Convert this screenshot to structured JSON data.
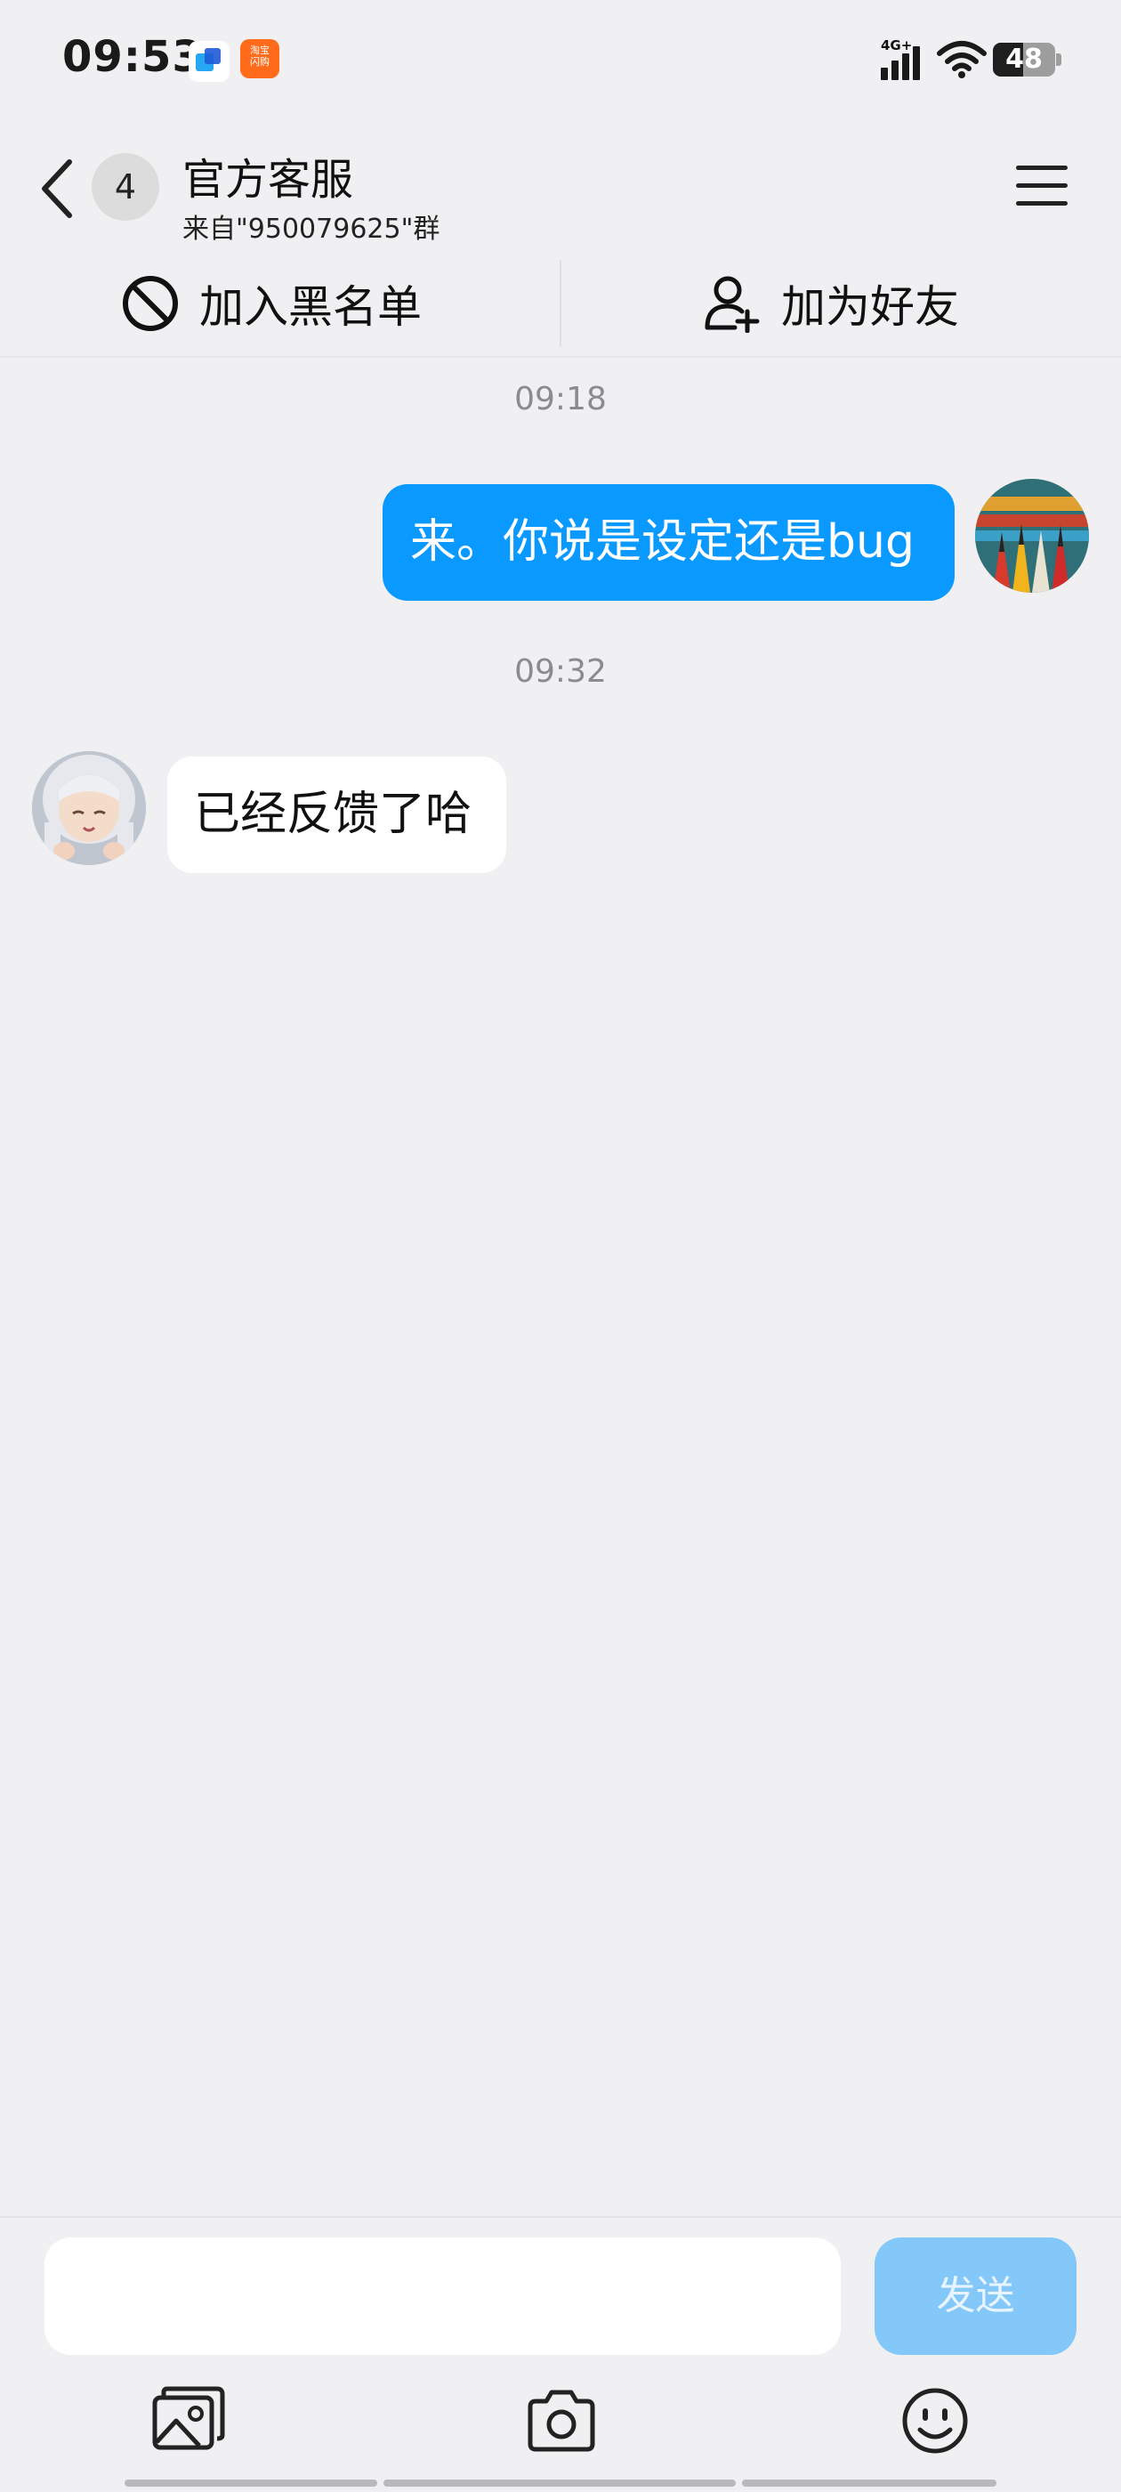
{
  "status": {
    "time": "09:53",
    "network": "4G+",
    "battery": "48",
    "battery_level": 0.48
  },
  "header": {
    "back_count": "4",
    "title": "官方客服",
    "subtitle": "来自\"950079625\"群"
  },
  "actions": {
    "block_label": "加入黑名单",
    "add_friend_label": "加为好友"
  },
  "messages": [
    {
      "timestamp": "09:18",
      "direction": "out",
      "text": "来。你说是设定还是bug"
    },
    {
      "timestamp": "09:32",
      "direction": "in",
      "text": "已经反馈了哈"
    }
  ],
  "composer": {
    "input_value": "",
    "send_label": "发送"
  },
  "icons": {
    "app1": "blue-app-icon",
    "app2": "taobao-flash-icon",
    "toolbar": [
      "image-icon",
      "camera-icon",
      "emoji-icon"
    ]
  },
  "colors": {
    "outgoing_bubble": "#0a99ff",
    "send_button": "#84c8f9",
    "background": "#f0f0f2"
  }
}
